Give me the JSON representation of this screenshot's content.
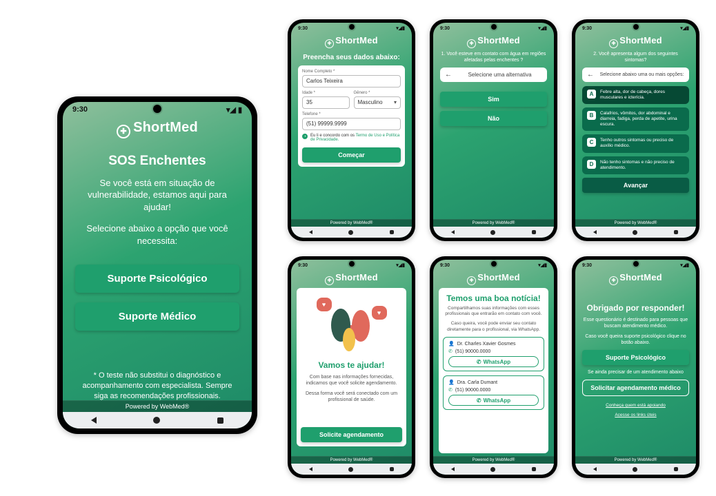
{
  "common": {
    "time": "9:30",
    "brand": "ShortMed",
    "footer": "Powered by WebMed®"
  },
  "screen1": {
    "title": "SOS Enchentes",
    "p1": "Se você está em situação de vulnerabilidade, estamos aqui para ajudar!",
    "p2": "Selecione abaixo a opção que você necessita:",
    "btn1": "Suporte Psicológico",
    "btn2": "Suporte Médico",
    "disclaimer": "* O teste não substitui o diagnóstico e acompanhamento com especialista. Sempre siga as recomendações profissionais."
  },
  "screen2": {
    "title": "Preencha seus dados abaixo:",
    "name_label": "Nome Completo *",
    "name_value": "Carlos Teixeira",
    "age_label": "Idade *",
    "age_value": "35",
    "gender_label": "Gênero *",
    "gender_value": "Masculino",
    "phone_label": "Telefone *",
    "phone_value": "(51) 99999.9999",
    "terms_pre": "Eu li e concordo com os ",
    "terms_link": "Termo de Uso e Política de Privacidade.",
    "btn": "Começar"
  },
  "screen3": {
    "question": "1. Você esteve em contato com água em regiões afetadas pelas enchentes ?",
    "prompt": "Selecione uma alternativa",
    "yes": "Sim",
    "no": "Não"
  },
  "screen4": {
    "question": "2. Você apresenta algum dos seguintes sintomas?",
    "prompt": "Selecione abaixo uma ou mais opções:",
    "A": "Febre alta, dor de cabeça, dores musculares e icterícia.",
    "B": "Calafrios, vômitos, dor abdominal e diarreia, fadiga, perda de apetite, urina escura.",
    "C": "Tenho outros sintomas ou preciso de auxílio médico.",
    "D": "Não tenho sintomas e não preciso de atendimento.",
    "btn": "Avançar"
  },
  "screen5": {
    "title": "Vamos te ajudar!",
    "p1": "Com base nas informações fornecidas, indicamos que você solicite agendamento.",
    "p2": "Dessa forma você será conectado com um profissional de saúde.",
    "btn": "Solicite agendamento"
  },
  "screen6": {
    "title": "Temos uma boa notícia!",
    "p1": "Compartilhamos suas informações com esses profissionais que entrarão em contato com você.",
    "p2": "Caso queira, você pode enviar seu contato diretamente para o profissional, via WhatsApp.",
    "doc1_name": "Dr. Charles Xavier Gosmes",
    "doc1_phone": "(51) 90000.0000",
    "doc2_name": "Dra. Carla Dumant",
    "doc2_phone": "(51) 90000.0000",
    "wa": "WhatsApp"
  },
  "screen7": {
    "title": "Obrigado por responder!",
    "p1": "Esse questionário é destinado para pessoas que buscam atendimento médico.",
    "p2": "Caso você queira suporte psicológico clique no botão abaixo.",
    "btn1": "Suporte Psicológico",
    "p3": "Se ainda precisar de um atendimento abaixo",
    "btn2": "Solicitar agendamento médico",
    "link1": "Conheça quem está apoiando",
    "link2": "Acesse os links úteis"
  }
}
